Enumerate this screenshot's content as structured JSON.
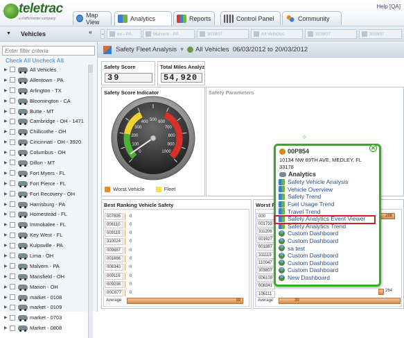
{
  "app": {
    "logo_text": "teletrac",
    "logo_sub": "a trafficmaster company",
    "help": "Help [QA]"
  },
  "nav": {
    "tabs": [
      {
        "label": "Map View"
      },
      {
        "label": "Analytics"
      },
      {
        "label": "Reports"
      },
      {
        "label": "Control Panel"
      },
      {
        "label": "Community"
      }
    ]
  },
  "sidebar": {
    "title": "Vehicles",
    "collapse": "«",
    "filter_placeholder": "Enter filter criteria",
    "check_all": "Check All",
    "uncheck_all": "Uncheck All",
    "vehicles": [
      "All Vehicles",
      "Allentown - PA",
      "Arlington - TX",
      "Bloomington - CA",
      "Butte - MT",
      "Cambridge - OH - 1471",
      "Chillicothe - OH",
      "Cincinnati - OH - 3920",
      "Columbus - OH",
      "Dillon - MT",
      "Fort Myers - FL",
      "Fort Pierce - FL",
      "Fort Recovery - OH",
      "Harrisburg - PA",
      "Homestead - FL",
      "Immokalee - FL",
      "Key West - FL",
      "Kulpsville - PA",
      "Lima - OH",
      "Malvern - PA",
      "Mansfield - OH",
      "Marion - OH",
      "market - 0108",
      "market - 0109",
      "market - 0703",
      "Market - 0808"
    ]
  },
  "filters": [
    "ev - PA",
    "Malvern - PA",
    "303807",
    "All Vehicles",
    "303807",
    "303807"
  ],
  "header": {
    "title": "Safety Fleet Analysis",
    "scope": "All Vehicles",
    "date_range": "06/03/2012 to 20/03/2012"
  },
  "panels": {
    "safety_score": {
      "title": "Safety Score",
      "value": "39"
    },
    "total_miles": {
      "title": "Total Miles Analyzed",
      "value": "54,920"
    },
    "indicator": {
      "title": "Safety Score Indicator",
      "gauge_value": 39,
      "legend_worst": "Worst Vehicle",
      "legend_fleet": "Fleet",
      "gauge_ticks": [
        "0",
        "100",
        "200",
        "300",
        "400",
        "500",
        "600",
        "700",
        "800",
        "900",
        "1000"
      ]
    },
    "params": {
      "title": "Safety Parameters"
    },
    "best": {
      "title": "Best Ranking Vehicle Safety",
      "rows": [
        {
          "id": "007895",
          "v": "0"
        },
        {
          "id": "006110",
          "v": "0"
        },
        {
          "id": "009119",
          "v": "0"
        },
        {
          "id": "310024",
          "v": "0"
        },
        {
          "id": "009887",
          "v": "0"
        },
        {
          "id": "001666",
          "v": "0"
        },
        {
          "id": "006340",
          "v": "0"
        },
        {
          "id": "009116",
          "v": "0"
        },
        {
          "id": "009298",
          "v": "0"
        },
        {
          "id": "00C877",
          "v": "0"
        }
      ],
      "average_label": "Average",
      "average_value": "39"
    },
    "worst": {
      "title": "Worst R",
      "rows": [
        "000",
        "001733",
        "311206",
        "001927",
        "001887",
        "311119",
        "110047",
        "303807",
        "006109",
        "006341",
        "106111"
      ],
      "top_value": "288",
      "low_value": "264",
      "average_label": "Average",
      "average_value": "39"
    }
  },
  "popup": {
    "vehicle": "00P854",
    "address": "10134 NW 89TH AVE, MEDLEY, FL 33178",
    "section": "Analytics",
    "items": [
      "Safety Vehicle Analysis",
      "Vehicle Overview",
      "Safety Trend",
      "Fuel Usage Trend",
      "Travel Trend",
      "Safety Analytics Event Viewer",
      "Safety Analytics Trend",
      "Custom Dashboard",
      "Custom Dashboard",
      "sa test",
      "Custom Dashboard",
      "Custom Dashboard",
      "Custom Dashboard",
      "New Dashboard"
    ],
    "highlighted": "Safety Analytics Event Viewer"
  },
  "colors": {
    "accent_green": "#3aa829",
    "highlight_red": "#d02020",
    "worst_swatch": "#f08a24",
    "fleet_swatch": "#f5e04a"
  }
}
